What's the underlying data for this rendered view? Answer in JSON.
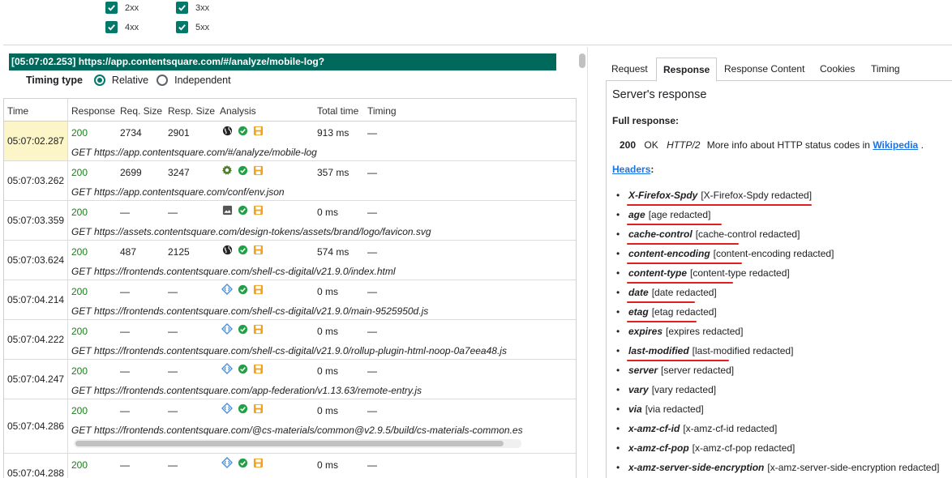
{
  "filters": {
    "items": [
      {
        "label": "2xx",
        "checked": true
      },
      {
        "label": "3xx",
        "checked": true
      },
      {
        "label": "4xx",
        "checked": true
      },
      {
        "label": "5xx",
        "checked": true
      }
    ]
  },
  "url_bar": "[05:07:02.253] https://app.contentsquare.com/#/analyze/mobile-log?",
  "timing": {
    "label": "Timing type",
    "options": [
      {
        "label": "Relative",
        "selected": true
      },
      {
        "label": "Independent",
        "selected": false
      }
    ]
  },
  "table": {
    "headers": [
      "Time",
      "Response",
      "Req. Size",
      "Resp. Size",
      "Analysis",
      "Total time",
      "Timing"
    ],
    "rows": [
      {
        "time": "05:07:02.287",
        "status": "200",
        "req": "2734",
        "resp": "2901",
        "type_icon": "globe-icon",
        "total": "913 ms",
        "timing": "—",
        "url": "GET https://app.contentsquare.com/#/analyze/mobile-log"
      },
      {
        "time": "05:07:03.262",
        "status": "200",
        "req": "2699",
        "resp": "3247",
        "type_icon": "gear-icon",
        "total": "357 ms",
        "timing": "—",
        "url": "GET https://app.contentsquare.com/conf/env.json"
      },
      {
        "time": "05:07:03.359",
        "status": "200",
        "req": "—",
        "resp": "—",
        "type_icon": "image-icon",
        "total": "0 ms",
        "timing": "—",
        "url": "GET https://assets.contentsquare.com/design-tokens/assets/brand/logo/favicon.svg"
      },
      {
        "time": "05:07:03.624",
        "status": "200",
        "req": "487",
        "resp": "2125",
        "type_icon": "globe-icon",
        "total": "574 ms",
        "timing": "—",
        "url": "GET https://frontends.contentsquare.com/shell-cs-digital/v21.9.0/index.html"
      },
      {
        "time": "05:07:04.214",
        "status": "200",
        "req": "—",
        "resp": "—",
        "type_icon": "script-icon",
        "total": "0 ms",
        "timing": "—",
        "url": "GET https://frontends.contentsquare.com/shell-cs-digital/v21.9.0/main-9525950d.js"
      },
      {
        "time": "05:07:04.222",
        "status": "200",
        "req": "—",
        "resp": "—",
        "type_icon": "script-icon",
        "total": "0 ms",
        "timing": "—",
        "url": "GET https://frontends.contentsquare.com/shell-cs-digital/v21.9.0/rollup-plugin-html-noop-0a7eea48.js"
      },
      {
        "time": "05:07:04.247",
        "status": "200",
        "req": "—",
        "resp": "—",
        "type_icon": "script-icon",
        "total": "0 ms",
        "timing": "—",
        "url": "GET https://frontends.contentsquare.com/app-federation/v1.13.63/remote-entry.js"
      },
      {
        "time": "05:07:04.286",
        "status": "200",
        "req": "—",
        "resp": "—",
        "type_icon": "script-icon",
        "total": "0 ms",
        "timing": "—",
        "url": "GET https://frontends.contentsquare.com/@cs-materials/common@v2.9.5/build/cs-materials-common.es"
      },
      {
        "time": "05:07:04.288",
        "status": "200",
        "req": "—",
        "resp": "—",
        "type_icon": "script-icon",
        "total": "0 ms",
        "timing": "—",
        "url": ""
      }
    ]
  },
  "tabs": [
    "Request",
    "Response",
    "Response Content",
    "Cookies",
    "Timing"
  ],
  "active_tab": "Response",
  "response": {
    "title": "Server's response",
    "full_label": "Full response:",
    "status_code": "200",
    "status_text": "OK",
    "protocol": "HTTP/2",
    "info": "More info about HTTP status codes in",
    "link": "Wikipedia",
    "link_suffix": ".",
    "headers_label": "Headers",
    "headers_colon": ":",
    "headers": [
      {
        "name": "X-Firefox-Spdy",
        "value": "[X-Firefox-Spdy redacted]",
        "underlined": true
      },
      {
        "name": "age",
        "value": "[age redacted]",
        "underlined": true
      },
      {
        "name": "cache-control",
        "value": "[cache-control redacted]",
        "underlined": true
      },
      {
        "name": "content-encoding",
        "value": "[content-encoding redacted]",
        "underlined": true
      },
      {
        "name": "content-type",
        "value": "[content-type redacted]",
        "underlined": true
      },
      {
        "name": "date",
        "value": "[date redacted]",
        "underlined": true
      },
      {
        "name": "etag",
        "value": "[etag redacted]",
        "underlined": true
      },
      {
        "name": "expires",
        "value": "[expires redacted]",
        "underlined": true
      },
      {
        "name": "last-modified",
        "value": "[last-modified redacted]",
        "underlined": true
      },
      {
        "name": "server",
        "value": "[server redacted]",
        "underlined": false
      },
      {
        "name": "vary",
        "value": "[vary redacted]",
        "underlined": false
      },
      {
        "name": "via",
        "value": "[via redacted]",
        "underlined": false
      },
      {
        "name": "x-amz-cf-id",
        "value": "[x-amz-cf-id redacted]",
        "underlined": false
      },
      {
        "name": "x-amz-cf-pop",
        "value": "[x-amz-cf-pop redacted]",
        "underlined": false
      },
      {
        "name": "x-amz-server-side-encryption",
        "value": "[x-amz-server-side-encryption redacted]",
        "underlined": false
      }
    ]
  },
  "colors": {
    "accent": "#00796b",
    "url_bar": "#00695c",
    "status_ok": "#1a7f1a",
    "highlight": "#fbf5c8",
    "annotation": "#e02020",
    "link": "#1a73e8"
  }
}
